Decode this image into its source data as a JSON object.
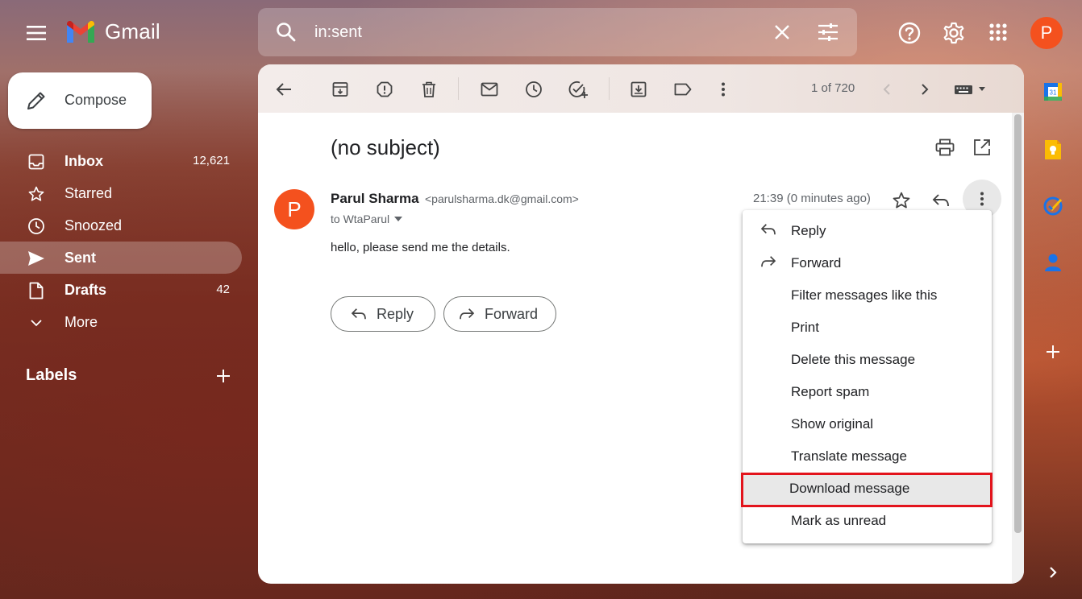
{
  "app": {
    "name": "Gmail"
  },
  "search": {
    "value": "in:sent",
    "placeholder": ""
  },
  "account": {
    "initial": "P"
  },
  "compose": {
    "label": "Compose"
  },
  "nav": {
    "items": [
      {
        "label": "Inbox",
        "count": "12,621"
      },
      {
        "label": "Starred",
        "count": ""
      },
      {
        "label": "Snoozed",
        "count": ""
      },
      {
        "label": "Sent",
        "count": ""
      },
      {
        "label": "Drafts",
        "count": "42"
      },
      {
        "label": "More",
        "count": ""
      }
    ],
    "labels_title": "Labels"
  },
  "toolbar": {
    "pager": "1 of 720"
  },
  "message": {
    "subject": "(no subject)",
    "sender_initial": "P",
    "sender_name": "Parul Sharma",
    "sender_email": "<parulsharma.dk@gmail.com>",
    "to": "to WtaParul",
    "time": "21:39 (0 minutes ago)",
    "body": "hello, please send me the details."
  },
  "actions": {
    "reply": "Reply",
    "forward": "Forward"
  },
  "menu": {
    "items": [
      {
        "label": "Reply"
      },
      {
        "label": "Forward"
      },
      {
        "label": "Filter messages like this"
      },
      {
        "label": "Print"
      },
      {
        "label": "Delete this message"
      },
      {
        "label": "Report spam"
      },
      {
        "label": "Show original"
      },
      {
        "label": "Translate message"
      },
      {
        "label": "Download message"
      },
      {
        "label": "Mark as unread"
      }
    ],
    "highlighted_index": 8
  },
  "side_panel": {
    "calendar_day": "31"
  },
  "colors": {
    "accent": "#f4511e",
    "highlight_border": "#e3141c",
    "calendar": "#1a73e8",
    "keep": "#fbbc04",
    "tasks": "#1a73e8",
    "contacts": "#1a73e8"
  }
}
